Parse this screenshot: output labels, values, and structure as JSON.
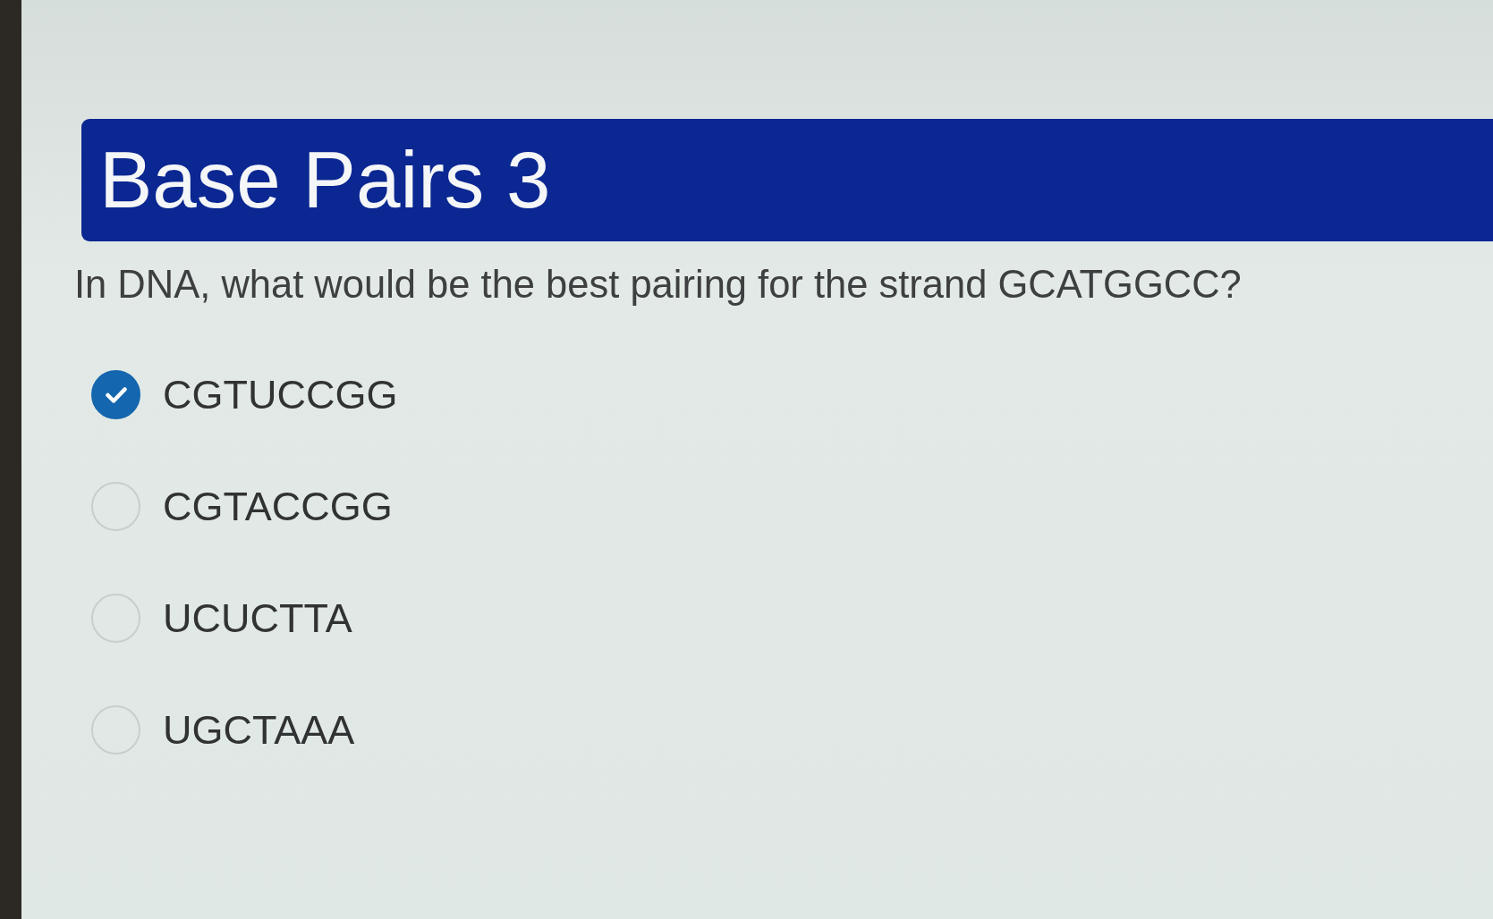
{
  "header": {
    "title": "Base Pairs 3"
  },
  "question": {
    "text": "In DNA, what would be the best pairing for the strand GCATGGCC?"
  },
  "options": [
    {
      "label": "CGTUCCGG",
      "selected": true
    },
    {
      "label": "CGTACCGG",
      "selected": false
    },
    {
      "label": "UCUCTTA",
      "selected": false
    },
    {
      "label": "UGCTAAA",
      "selected": false
    }
  ]
}
